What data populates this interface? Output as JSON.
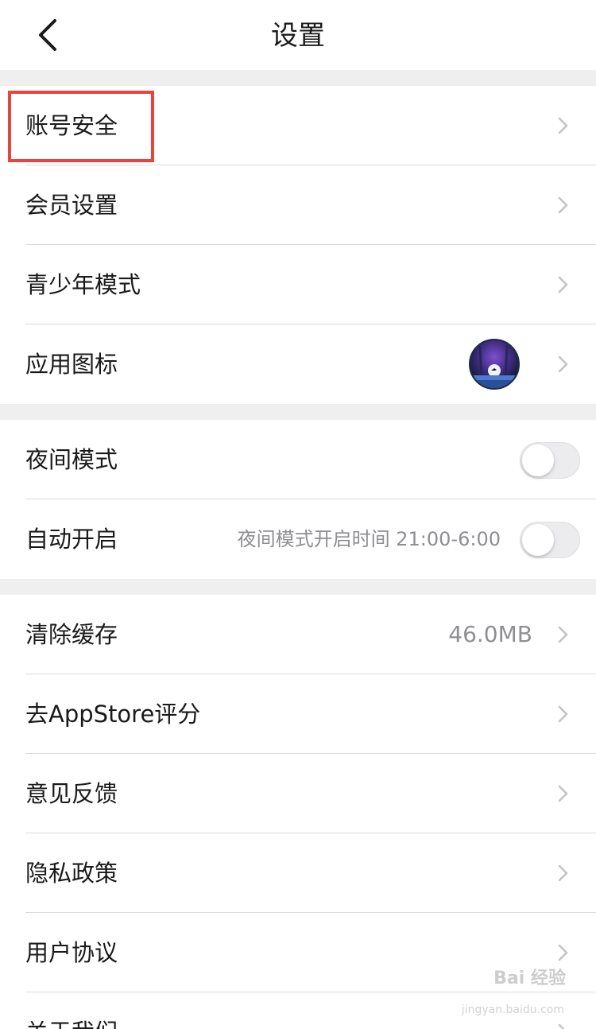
{
  "nav": {
    "title": "设置",
    "back_icon": "chevron-left-icon"
  },
  "sections": {
    "account": [
      {
        "label": "账号安全"
      },
      {
        "label": "会员设置"
      },
      {
        "label": "青少年模式"
      },
      {
        "label": "应用图标"
      }
    ],
    "night": {
      "night_mode": {
        "label": "夜间模式",
        "on": false
      },
      "auto_on": {
        "label": "自动开启",
        "sublabel": "夜间模式开启时间 21:00-6:00",
        "on": false
      }
    },
    "other": [
      {
        "label": "清除缓存",
        "value": "46.0MB"
      },
      {
        "label": "去AppStore评分"
      },
      {
        "label": "意见反馈"
      },
      {
        "label": "隐私政策"
      },
      {
        "label": "用户协议"
      },
      {
        "label": "关于我们"
      }
    ]
  },
  "annotation": {
    "color": "#e8433e"
  },
  "watermark": {
    "text": "Bai 经验",
    "sub": "jingyan.baidu.com"
  },
  "colors": {
    "background_gap": "#efeff0",
    "secondary_text": "#8e8e93",
    "divider": "#dcdcde"
  }
}
